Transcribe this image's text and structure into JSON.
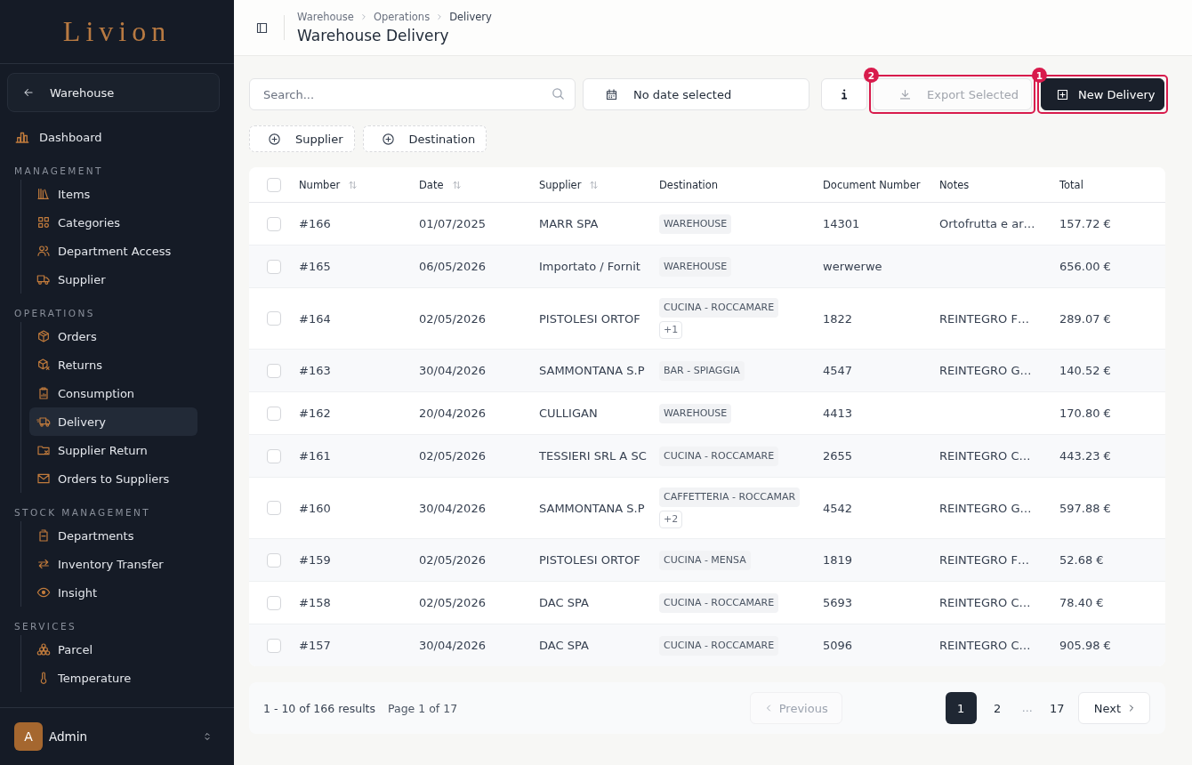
{
  "sidebar": {
    "logo": "Livion",
    "back_button": {
      "label": "Warehouse"
    },
    "nav": [
      {
        "label": "Dashboard",
        "selected": false
      }
    ],
    "sections": [
      {
        "title": "MANAGEMENT",
        "items": [
          {
            "label": "Items",
            "selected": false
          },
          {
            "label": "Categories",
            "selected": false
          },
          {
            "label": "Department Access",
            "selected": false
          },
          {
            "label": "Supplier",
            "selected": false
          }
        ]
      },
      {
        "title": "OPERATIONS",
        "items": [
          {
            "label": "Orders",
            "selected": false
          },
          {
            "label": "Returns",
            "selected": false
          },
          {
            "label": "Consumption",
            "selected": false
          },
          {
            "label": "Delivery",
            "selected": true
          },
          {
            "label": "Supplier Return",
            "selected": false
          },
          {
            "label": "Orders to Suppliers",
            "selected": false
          }
        ]
      },
      {
        "title": "STOCK MANAGEMENT",
        "items": [
          {
            "label": "Departments",
            "selected": false
          },
          {
            "label": "Inventory Transfer",
            "selected": false
          },
          {
            "label": "Insight",
            "selected": false
          }
        ]
      },
      {
        "title": "SERVICES",
        "items": [
          {
            "label": "Parcel",
            "selected": false
          },
          {
            "label": "Temperature",
            "selected": false
          }
        ]
      }
    ],
    "user": {
      "initial": "A",
      "name": "Admin"
    }
  },
  "header": {
    "breadcrumb": [
      "Warehouse",
      "Operations",
      "Delivery"
    ],
    "title": "Warehouse Delivery"
  },
  "toolbar": {
    "search": {
      "placeholder": "Search..."
    },
    "date_picker": {
      "label": "No date selected"
    },
    "actions": [
      {
        "kind": "info"
      },
      {
        "kind": "export",
        "label": "Export Selected",
        "disabled": true,
        "tour_step": "2"
      },
      {
        "kind": "create",
        "label": "New Delivery",
        "disabled": false,
        "tour_step": "1"
      }
    ]
  },
  "filters": [
    {
      "label": "Supplier"
    },
    {
      "label": "Destination"
    }
  ],
  "table": {
    "select_all": {
      "checked": false
    },
    "columns": [
      {
        "label": "Number",
        "sortable": true
      },
      {
        "label": "Date",
        "sortable": true
      },
      {
        "label": "Supplier",
        "sortable": true
      },
      {
        "label": "Destination",
        "sortable": false
      },
      {
        "label": "Document Number",
        "sortable": false
      },
      {
        "label": "Notes",
        "sortable": false
      },
      {
        "label": "Total",
        "sortable": false
      }
    ],
    "rows": [
      {
        "checked": false,
        "number": "#166",
        "date": "01/07/2025",
        "supplier": "MARR SPA",
        "destination": "WAREHOUSE",
        "document_number": "14301",
        "notes": "Ortofrutta e ar…",
        "total": "157.72 €"
      },
      {
        "checked": false,
        "number": "#165",
        "date": "06/05/2026",
        "supplier": "Importato / Fornit",
        "destination": "WAREHOUSE",
        "document_number": "werwerwe",
        "total": "656.00 €"
      },
      {
        "checked": false,
        "number": "#164",
        "date": "02/05/2026",
        "supplier": "PISTOLESI ORTOF",
        "destination": "CUCINA - ROCCAMARE",
        "more_destinations": "+1",
        "document_number": "1822",
        "notes": "REINTEGRO F…",
        "total": "289.07 €"
      },
      {
        "checked": false,
        "number": "#163",
        "date": "30/04/2026",
        "supplier": "SAMMONTANA S.P",
        "destination": "BAR - SPIAGGIA",
        "document_number": "4547",
        "notes": "REINTEGRO G…",
        "total": "140.52 €"
      },
      {
        "checked": false,
        "number": "#162",
        "date": "20/04/2026",
        "supplier": "CULLIGAN",
        "destination": "WAREHOUSE",
        "document_number": "4413",
        "total": "170.80 €"
      },
      {
        "checked": false,
        "number": "#161",
        "date": "02/05/2026",
        "supplier": "TESSIERI SRL A SC",
        "destination": "CUCINA - ROCCAMARE",
        "document_number": "2655",
        "notes": "REINTEGRO C…",
        "total": "443.23 €"
      },
      {
        "checked": false,
        "number": "#160",
        "date": "30/04/2026",
        "supplier": "SAMMONTANA S.P",
        "destination": "CAFFETTERIA - ROCCAMAR",
        "more_destinations": "+2",
        "document_number": "4542",
        "notes": "REINTEGRO G…",
        "total": "597.88 €"
      },
      {
        "checked": false,
        "number": "#159",
        "date": "02/05/2026",
        "supplier": "PISTOLESI ORTOF",
        "destination": "CUCINA - MENSA",
        "document_number": "1819",
        "notes": "REINTEGRO F…",
        "total": "52.68 €"
      },
      {
        "checked": false,
        "number": "#158",
        "date": "02/05/2026",
        "supplier": "DAC SPA",
        "destination": "CUCINA - ROCCAMARE",
        "document_number": "5693",
        "notes": "REINTEGRO C…",
        "total": "78.40 €"
      },
      {
        "checked": false,
        "number": "#157",
        "date": "30/04/2026",
        "supplier": "DAC SPA",
        "destination": "CUCINA - ROCCAMARE",
        "document_number": "5096",
        "notes": "REINTEGRO C…",
        "total": "905.98 €"
      }
    ]
  },
  "pagination": {
    "summary": "1 - 10 of 166 results",
    "page_label": "Page 1 of 17",
    "previous": {
      "label": "Previous",
      "disabled": true
    },
    "pages": [
      {
        "kind": "page",
        "label": "1",
        "selected": true
      },
      {
        "kind": "page",
        "label": "2",
        "selected": false
      },
      {
        "kind": "gap",
        "label": "…"
      },
      {
        "kind": "page",
        "label": "17",
        "selected": false
      }
    ],
    "next": {
      "label": "Next",
      "disabled": false
    }
  }
}
